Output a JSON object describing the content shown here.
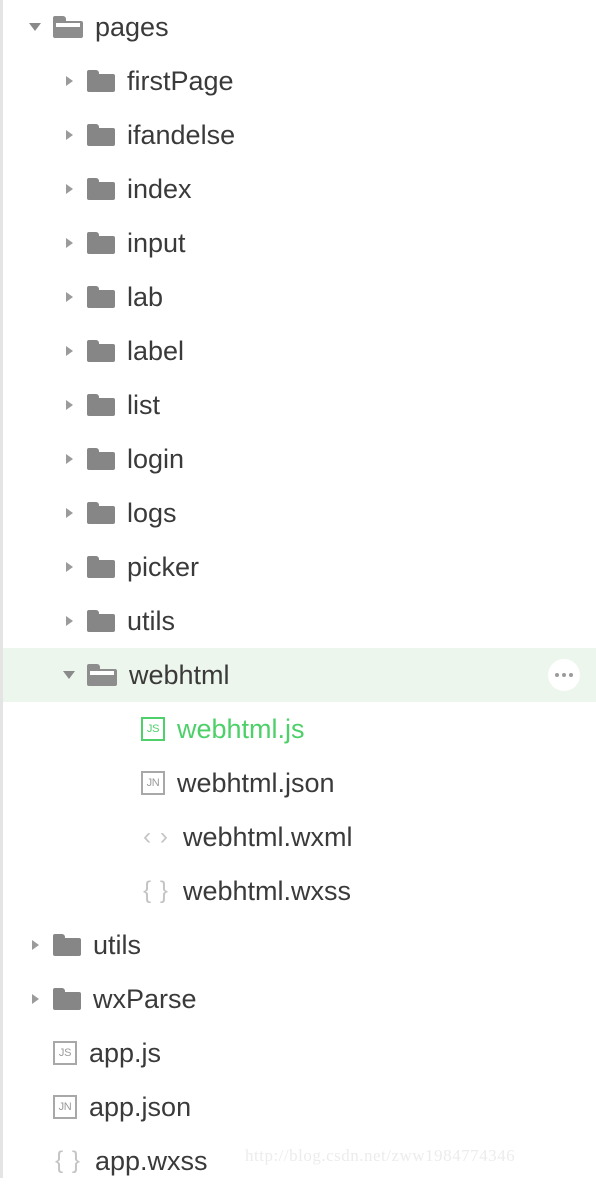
{
  "tree": {
    "root_label": "pages",
    "rows": [
      {
        "label": "pages",
        "level": 0,
        "icon": "folder-open-icon",
        "arrow": "expanded",
        "selected": false,
        "more": false
      },
      {
        "label": "firstPage",
        "level": 1,
        "icon": "folder-closed-icon",
        "arrow": "collapsed",
        "selected": false,
        "more": false
      },
      {
        "label": "ifandelse",
        "level": 1,
        "icon": "folder-closed-icon",
        "arrow": "collapsed",
        "selected": false,
        "more": false
      },
      {
        "label": "index",
        "level": 1,
        "icon": "folder-closed-icon",
        "arrow": "collapsed",
        "selected": false,
        "more": false
      },
      {
        "label": "input",
        "level": 1,
        "icon": "folder-closed-icon",
        "arrow": "collapsed",
        "selected": false,
        "more": false
      },
      {
        "label": "lab",
        "level": 1,
        "icon": "folder-closed-icon",
        "arrow": "collapsed",
        "selected": false,
        "more": false
      },
      {
        "label": "label",
        "level": 1,
        "icon": "folder-closed-icon",
        "arrow": "collapsed",
        "selected": false,
        "more": false
      },
      {
        "label": "list",
        "level": 1,
        "icon": "folder-closed-icon",
        "arrow": "collapsed",
        "selected": false,
        "more": false
      },
      {
        "label": "login",
        "level": 1,
        "icon": "folder-closed-icon",
        "arrow": "collapsed",
        "selected": false,
        "more": false
      },
      {
        "label": "logs",
        "level": 1,
        "icon": "folder-closed-icon",
        "arrow": "collapsed",
        "selected": false,
        "more": false
      },
      {
        "label": "picker",
        "level": 1,
        "icon": "folder-closed-icon",
        "arrow": "collapsed",
        "selected": false,
        "more": false
      },
      {
        "label": "utils",
        "level": 1,
        "icon": "folder-closed-icon",
        "arrow": "collapsed",
        "selected": false,
        "more": false
      },
      {
        "label": "webhtml",
        "level": 1,
        "icon": "folder-open-icon",
        "arrow": "expanded",
        "selected": true,
        "more": true
      },
      {
        "label": "webhtml.js",
        "level": 2,
        "icon": "js-file-icon",
        "arrow": "none",
        "selected": false,
        "more": false,
        "accent": true
      },
      {
        "label": "webhtml.json",
        "level": 2,
        "icon": "json-file-icon",
        "arrow": "none",
        "selected": false,
        "more": false
      },
      {
        "label": "webhtml.wxml",
        "level": 2,
        "icon": "wxml-file-icon",
        "arrow": "none",
        "selected": false,
        "more": false
      },
      {
        "label": "webhtml.wxss",
        "level": 2,
        "icon": "wxss-file-icon",
        "arrow": "none",
        "selected": false,
        "more": false
      },
      {
        "label": "utils",
        "level": 0,
        "icon": "folder-closed-icon",
        "arrow": "collapsed",
        "selected": false,
        "more": false
      },
      {
        "label": "wxParse",
        "level": 0,
        "icon": "folder-closed-icon",
        "arrow": "collapsed",
        "selected": false,
        "more": false
      },
      {
        "label": "app.js",
        "level": 0,
        "icon": "js-file-icon",
        "arrow": "none",
        "selected": false,
        "more": false
      },
      {
        "label": "app.json",
        "level": 0,
        "icon": "json-file-icon",
        "arrow": "none",
        "selected": false,
        "more": false
      },
      {
        "label": "app.wxss",
        "level": 0,
        "icon": "wxss-file-icon",
        "arrow": "none",
        "selected": false,
        "more": false
      }
    ]
  },
  "icons": {
    "js_badge_text": "JS",
    "json_badge_text": "JN",
    "wxml_glyph": "‹ ›",
    "wxss_glyph": "{ }",
    "more_label": "•••"
  },
  "watermark": {
    "text": "http://blog.csdn.net/zww1984774346"
  },
  "colors": {
    "accent_green": "#4ed069",
    "selected_row_bg": "#ecf6ec",
    "folder_gray": "#8a8a8a",
    "label_text": "#3a3a3a",
    "icon_gray": "#a8a8a8",
    "watermark_gray": "#ececec"
  }
}
